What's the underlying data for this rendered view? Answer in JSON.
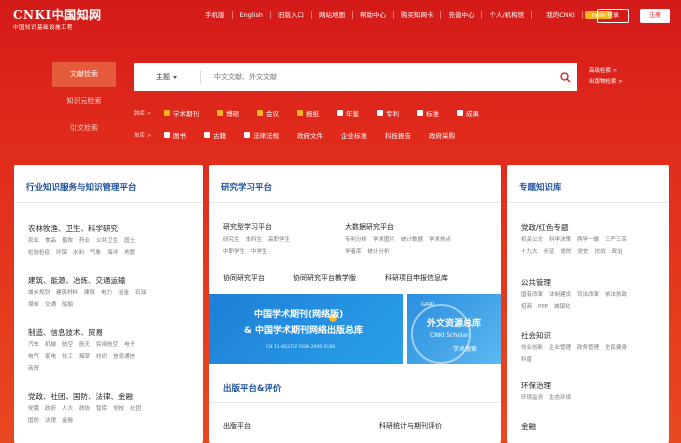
{
  "logo": {
    "main": "CNKI中国知网",
    "url": "www.cnki.net",
    "sub": "中国知识基础设施工程"
  },
  "topnav": [
    "手机版",
    "English",
    "旧版入口",
    "网站地图",
    "帮助中心",
    "购买知网卡",
    "充值中心",
    "个人/机构馆",
    "我的CNKI"
  ],
  "topnav_badge": "new",
  "auth": {
    "login": "登录",
    "register": "注册"
  },
  "side_tabs": [
    "文献检索",
    "知识元检索",
    "引文检索"
  ],
  "search": {
    "scope": "主题",
    "placeholder": "中文文献、外文文献"
  },
  "adv_links": [
    "高级检索 >",
    "出版物检索 >"
  ],
  "row1": {
    "label": "跨库 >",
    "options": [
      {
        "text": "学术期刊",
        "checked": true
      },
      {
        "text": "博硕",
        "checked": true
      },
      {
        "text": "会议",
        "checked": true
      },
      {
        "text": "报纸",
        "checked": true
      },
      {
        "text": "年鉴",
        "checked": false
      },
      {
        "text": "专利",
        "checked": false
      },
      {
        "text": "标准",
        "checked": false
      },
      {
        "text": "成果",
        "checked": false
      }
    ]
  },
  "row2": {
    "label": "单库 >",
    "options": [
      {
        "text": "图书",
        "checked": false,
        "box": true
      },
      {
        "text": "古籍",
        "checked": false,
        "box": true
      },
      {
        "text": "法律法规",
        "checked": false,
        "box": true
      },
      {
        "text": "政府文件",
        "checked": false,
        "box": false
      },
      {
        "text": "企业标准",
        "checked": false,
        "box": false
      },
      {
        "text": "科技报告",
        "checked": false,
        "box": false
      },
      {
        "text": "政府采购",
        "checked": false,
        "box": false
      }
    ]
  },
  "card1": {
    "title": "行业知识服务与知识管理平台",
    "cats": [
      {
        "title": "农林牧渔、卫生、科学研究",
        "items": [
          [
            "农业",
            "食品",
            "畜牧",
            "药业",
            "公共卫生",
            "国土"
          ],
          [
            "检验检疫",
            "环保",
            "水利",
            "气象",
            "海洋",
            "地震"
          ]
        ]
      },
      {
        "title": "建筑、能源、冶炼、交通运输",
        "items": [
          [
            "城乡规划",
            "建筑材料",
            "建筑",
            "电力",
            "冶金",
            "石油"
          ],
          [
            "煤炭",
            "交通",
            "船舶"
          ]
        ]
      },
      {
        "title": "制造、信息技术、贸易",
        "items": [
          [
            "汽车",
            "机械",
            "航空",
            "航天",
            "民用航空",
            "电子"
          ],
          [
            "电气",
            "家电",
            "化工",
            "烟草",
            "纺织",
            "信息通信"
          ],
          [
            "商贸"
          ]
        ]
      },
      {
        "title": "党政、社团、国防、法律、金融",
        "items": [
          [
            "党委",
            "政府",
            "人大",
            "政协",
            "智库",
            "党校",
            "社团"
          ],
          [
            "国防",
            "法律",
            "金融"
          ]
        ]
      }
    ]
  },
  "card2": {
    "title": "研究学习平台",
    "col1_title": "研究型学习平台",
    "col1_items": [
      [
        "研究生",
        "本科生",
        "高职学生"
      ],
      [
        "中职学生",
        "中学生"
      ]
    ],
    "col2_title": "大数据研究平台",
    "col2_items": [
      [
        "专利分析",
        "学术图片",
        "统计数据",
        "学术热点"
      ],
      [
        "学者库",
        "统计分析"
      ]
    ],
    "links": [
      "协同研究平台",
      "协同研究平台教学版",
      "科研项目申报信息库"
    ],
    "banner1": {
      "t1": "中国学术期刊(网络版)",
      "t2": "& 中国学术期刊网络出版总库",
      "t3": "CN 11-6037/Z    ISSN 2096-4188"
    },
    "banner2": {
      "gari": "GARI",
      "t1": "外文资源总库",
      "t2": "CNKI Scholar",
      "t3": "学术搜索"
    },
    "pub_title": "出版平台&评价",
    "pub_sub1": "出版平台",
    "pub_sub2": "科研统计与期刊评价"
  },
  "card3": {
    "title": "专题知识库",
    "sections": [
      {
        "title": "党政/红色专题",
        "items": [
          [
            "机关公文",
            "科学决策",
            "两学一做",
            "三严三实"
          ],
          [
            "十九大",
            "长征",
            "党的",
            "党史",
            "抗战",
            "政治"
          ]
        ]
      },
      {
        "title": "公共管理",
        "items": [
          [
            "国有改革",
            "法制建设",
            "司法改革",
            "依法执政"
          ],
          [
            "招商",
            "PPP",
            "城镇化"
          ]
        ]
      },
      {
        "title": "社会知识",
        "items": [
          [
            "创业创新",
            "企业管理",
            "政务管理",
            "全民健身"
          ],
          [
            "科普"
          ]
        ]
      },
      {
        "title": "环保治理",
        "items": [
          [
            "环境监测",
            "生态环境"
          ]
        ]
      },
      {
        "title": "金融",
        "items": []
      }
    ]
  },
  "colors": {
    "brand_red": "#d41a18",
    "accent_yellow": "#f7b51e",
    "title_blue": "#1a4f9c"
  }
}
